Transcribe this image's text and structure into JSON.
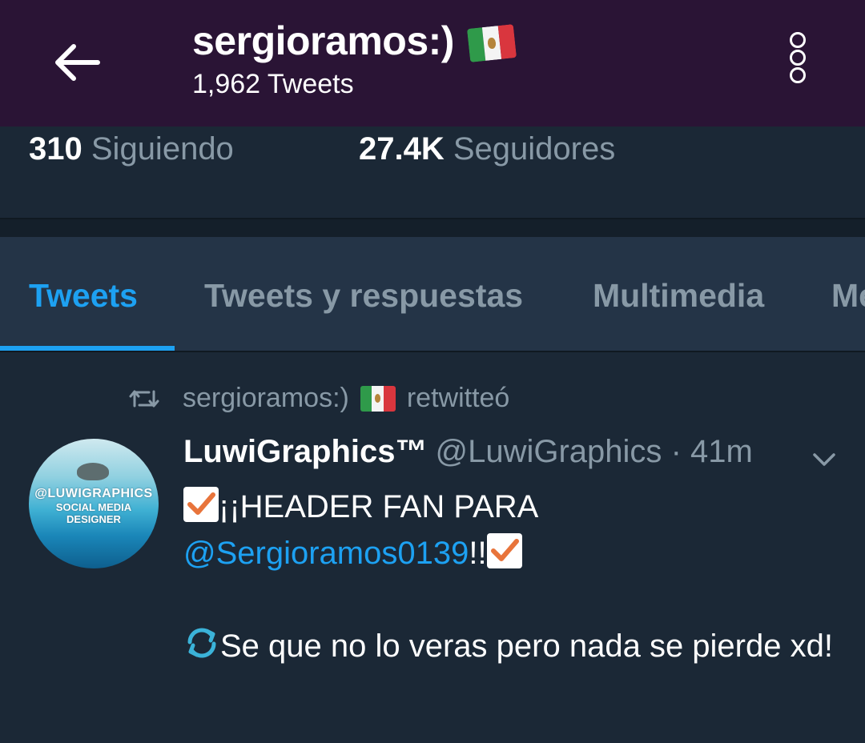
{
  "header": {
    "title": "sergioramos:)",
    "tweet_count": "1,962 Tweets"
  },
  "stats": {
    "following_count": "310",
    "following_label": "Siguiendo",
    "followers_count": "27.4K",
    "followers_label": "Seguidores"
  },
  "tabs": [
    {
      "label": "Tweets",
      "active": true
    },
    {
      "label": "Tweets y respuestas",
      "active": false
    },
    {
      "label": "Multimedia",
      "active": false
    },
    {
      "label": "Me",
      "active": false
    }
  ],
  "retweet": {
    "user": "sergioramos:)",
    "action": "retwitteó"
  },
  "tweet": {
    "author": "LuwiGraphics™",
    "handle": "@LuwiGraphics",
    "separator": "·",
    "time": "41m",
    "line1": "¡¡HEADER FAN PARA",
    "mention": "@Sergioramos0139",
    "excl": "!!",
    "line3": "Se que no lo veras pero nada  se pierde xd!",
    "avatar_text_1": "@LUWIGRAPHICS",
    "avatar_text_2": "SOCIAL MEDIA DESIGNER"
  },
  "icons": {
    "back": "arrow-left-icon",
    "menu": "more-vertical-icon",
    "flag": "mexico-flag-icon",
    "retweet": "retweet-icon",
    "caret": "chevron-down-icon",
    "check": "check-mark-emoji",
    "refresh": "counterclockwise-arrows-emoji"
  },
  "colors": {
    "header_bg": "#2a1435",
    "page_bg": "#1b2836",
    "tabs_bg": "#243447",
    "accent": "#1da1f2",
    "secondary_text": "#8899a6"
  }
}
